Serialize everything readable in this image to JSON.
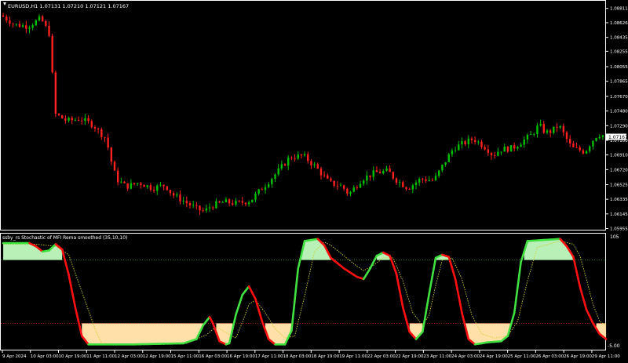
{
  "main": {
    "symbol_line": "EURUSD,H1  1.07131 1.07210 1.07121 1.07167",
    "price_labels": [
      "1.08811",
      "1.08626",
      "1.08435",
      "1.08255",
      "1.08055",
      "1.07865",
      "1.07670",
      "1.07480",
      "1.07290",
      "1.07100",
      "1.06910",
      "1.06720",
      "1.06525",
      "1.06335",
      "1.06145",
      "1.05955"
    ],
    "current_price": "1.07167",
    "colors": {
      "bull": "#00c000",
      "bear": "#ff2020",
      "grid": "#3a3a3a",
      "frame": "#ffffff",
      "text": "#ffffff"
    }
  },
  "sub": {
    "title": "ssby_rs Stochastic of MFI Rema smoothed (35,10,10)",
    "scale_top": "105",
    "scale_bottom": "-5.00",
    "colors": {
      "up_line": "#40e040",
      "down_line": "#ff1010",
      "signal": "#d0d030",
      "upper_fill": "#b8f0b8",
      "lower_fill": "#ffe0a8",
      "upper_level": "#30a030",
      "lower_level": "#c02020"
    }
  },
  "time_labels": [
    "9 Apr 2024",
    "10 Apr 03:00",
    "10 Apr 19:00",
    "11 Apr 11:00",
    "12 Apr 03:00",
    "12 Apr 19:00",
    "15 Apr 11:00",
    "16 Apr 03:00",
    "16 Apr 19:00",
    "17 Apr 11:00",
    "18 Apr 03:00",
    "18 Apr 19:00",
    "19 Apr 11:00",
    "22 Apr 03:00",
    "22 Apr 19:00",
    "23 Apr 11:00",
    "24 Apr 03:00",
    "24 Apr 19:00",
    "25 Apr 11:00",
    "26 Apr 03:00",
    "26 Apr 19:00",
    "29 Apr 11:00"
  ],
  "chart_data": [
    {
      "type": "candlestick",
      "title": "EURUSD,H1",
      "ylim": [
        1.0595,
        1.089
      ],
      "close_path": [
        [
          0,
          1.0872
        ],
        [
          4,
          1.086
        ],
        [
          8,
          1.0858
        ],
        [
          12,
          1.0868
        ],
        [
          15,
          1.0845
        ],
        [
          16,
          1.0745
        ],
        [
          20,
          1.0735
        ],
        [
          24,
          1.0738
        ],
        [
          28,
          1.073
        ],
        [
          30,
          1.072
        ],
        [
          32,
          1.0712
        ],
        [
          33,
          1.069
        ],
        [
          35,
          1.066
        ],
        [
          38,
          1.065
        ],
        [
          42,
          1.0655
        ],
        [
          46,
          1.0648
        ],
        [
          50,
          1.0652
        ],
        [
          52,
          1.064
        ],
        [
          56,
          1.063
        ],
        [
          60,
          1.062
        ],
        [
          62,
          1.0618
        ],
        [
          64,
          1.0625
        ],
        [
          68,
          1.063
        ],
        [
          72,
          1.0628
        ],
        [
          76,
          1.0632
        ],
        [
          80,
          1.065
        ],
        [
          84,
          1.0668
        ],
        [
          88,
          1.0688
        ],
        [
          92,
          1.069
        ],
        [
          96,
          1.0675
        ],
        [
          100,
          1.0655
        ],
        [
          104,
          1.065
        ],
        [
          106,
          1.064
        ],
        [
          110,
          1.066
        ],
        [
          114,
          1.0668
        ],
        [
          118,
          1.067
        ],
        [
          120,
          1.066
        ],
        [
          124,
          1.0648
        ],
        [
          128,
          1.066
        ],
        [
          132,
          1.0658
        ],
        [
          135,
          1.068
        ],
        [
          138,
          1.07
        ],
        [
          142,
          1.0708
        ],
        [
          144,
          1.0712
        ],
        [
          148,
          1.07
        ],
        [
          150,
          1.069
        ],
        [
          152,
          1.0698
        ],
        [
          156,
          1.07
        ],
        [
          160,
          1.0712
        ],
        [
          162,
          1.0718
        ],
        [
          164,
          1.073
        ],
        [
          166,
          1.072
        ],
        [
          168,
          1.0722
        ],
        [
          170,
          1.073
        ],
        [
          172,
          1.0715
        ],
        [
          174,
          1.07
        ],
        [
          176,
          1.0698
        ],
        [
          178,
          1.0695
        ],
        [
          180,
          1.0708
        ],
        [
          182,
          1.0718
        ],
        [
          184,
          1.0716
        ]
      ],
      "current_price": 1.07167
    },
    {
      "type": "line",
      "title": "ssby_rs Stochastic of MFI Rema smoothed (35,10,10)",
      "ylim": [
        -5,
        105
      ],
      "levels": [
        80,
        20
      ],
      "series": [
        {
          "values_path": [
            [
              0,
              96
            ],
            [
              8,
              96
            ],
            [
              10,
              93
            ],
            [
              12,
              88
            ],
            [
              14,
              89
            ],
            [
              16,
              95
            ],
            [
              18,
              90
            ],
            [
              20,
              66
            ],
            [
              22,
              35
            ],
            [
              24,
              8
            ],
            [
              26,
              0
            ],
            [
              40,
              0
            ],
            [
              55,
              1
            ],
            [
              59,
              5
            ],
            [
              61,
              18
            ],
            [
              63,
              26
            ],
            [
              64,
              20
            ],
            [
              66,
              3
            ],
            [
              68,
              0
            ],
            [
              69,
              1
            ],
            [
              71,
              28
            ],
            [
              73,
              47
            ],
            [
              75,
              55
            ],
            [
              77,
              43
            ],
            [
              79,
              22
            ],
            [
              81,
              5
            ],
            [
              83,
              0
            ],
            [
              86,
              0
            ],
            [
              88,
              13
            ],
            [
              90,
              72
            ],
            [
              92,
              98
            ],
            [
              96,
              100
            ],
            [
              98,
              94
            ],
            [
              100,
              82
            ],
            [
              104,
              72
            ],
            [
              108,
              64
            ],
            [
              110,
              62
            ],
            [
              112,
              72
            ],
            [
              114,
              84
            ],
            [
              116,
              87
            ],
            [
              118,
              84
            ],
            [
              120,
              67
            ],
            [
              122,
              35
            ],
            [
              124,
              12
            ],
            [
              126,
              5
            ],
            [
              128,
              12
            ],
            [
              130,
              48
            ],
            [
              132,
              82
            ],
            [
              134,
              85
            ],
            [
              136,
              83
            ],
            [
              138,
              62
            ],
            [
              140,
              30
            ],
            [
              142,
              5
            ],
            [
              144,
              0
            ],
            [
              148,
              2
            ],
            [
              152,
              3
            ],
            [
              154,
              8
            ],
            [
              156,
              30
            ],
            [
              158,
              78
            ],
            [
              160,
              98
            ],
            [
              170,
              100
            ],
            [
              172,
              93
            ],
            [
              174,
              83
            ],
            [
              176,
              55
            ],
            [
              178,
              33
            ],
            [
              180,
              20
            ],
            [
              182,
              10
            ],
            [
              184,
              5
            ]
          ]
        },
        {
          "values_path": [
            [
              0,
              95
            ],
            [
              10,
              95
            ],
            [
              16,
              93
            ],
            [
              20,
              85
            ],
            [
              24,
              50
            ],
            [
              28,
              15
            ],
            [
              30,
              1
            ],
            [
              40,
              0
            ],
            [
              56,
              1
            ],
            [
              62,
              9
            ],
            [
              65,
              17
            ],
            [
              68,
              11
            ],
            [
              71,
              6
            ],
            [
              73,
              21
            ],
            [
              75,
              38
            ],
            [
              77,
              42
            ],
            [
              80,
              30
            ],
            [
              83,
              15
            ],
            [
              86,
              6
            ],
            [
              89,
              8
            ],
            [
              92,
              46
            ],
            [
              95,
              88
            ],
            [
              98,
              97
            ],
            [
              100,
              94
            ],
            [
              104,
              84
            ],
            [
              108,
              74
            ],
            [
              110,
              70
            ],
            [
              113,
              75
            ],
            [
              116,
              82
            ],
            [
              119,
              82
            ],
            [
              122,
              60
            ],
            [
              125,
              30
            ],
            [
              128,
              18
            ],
            [
              130,
              28
            ],
            [
              132,
              56
            ],
            [
              134,
              80
            ],
            [
              137,
              82
            ],
            [
              140,
              62
            ],
            [
              143,
              28
            ],
            [
              146,
              10
            ],
            [
              150,
              6
            ],
            [
              154,
              8
            ],
            [
              157,
              22
            ],
            [
              160,
              60
            ],
            [
              163,
              92
            ],
            [
              170,
              98
            ],
            [
              174,
              95
            ],
            [
              176,
              84
            ],
            [
              178,
              62
            ],
            [
              180,
              38
            ],
            [
              182,
              22
            ],
            [
              184,
              18
            ]
          ]
        }
      ]
    }
  ]
}
